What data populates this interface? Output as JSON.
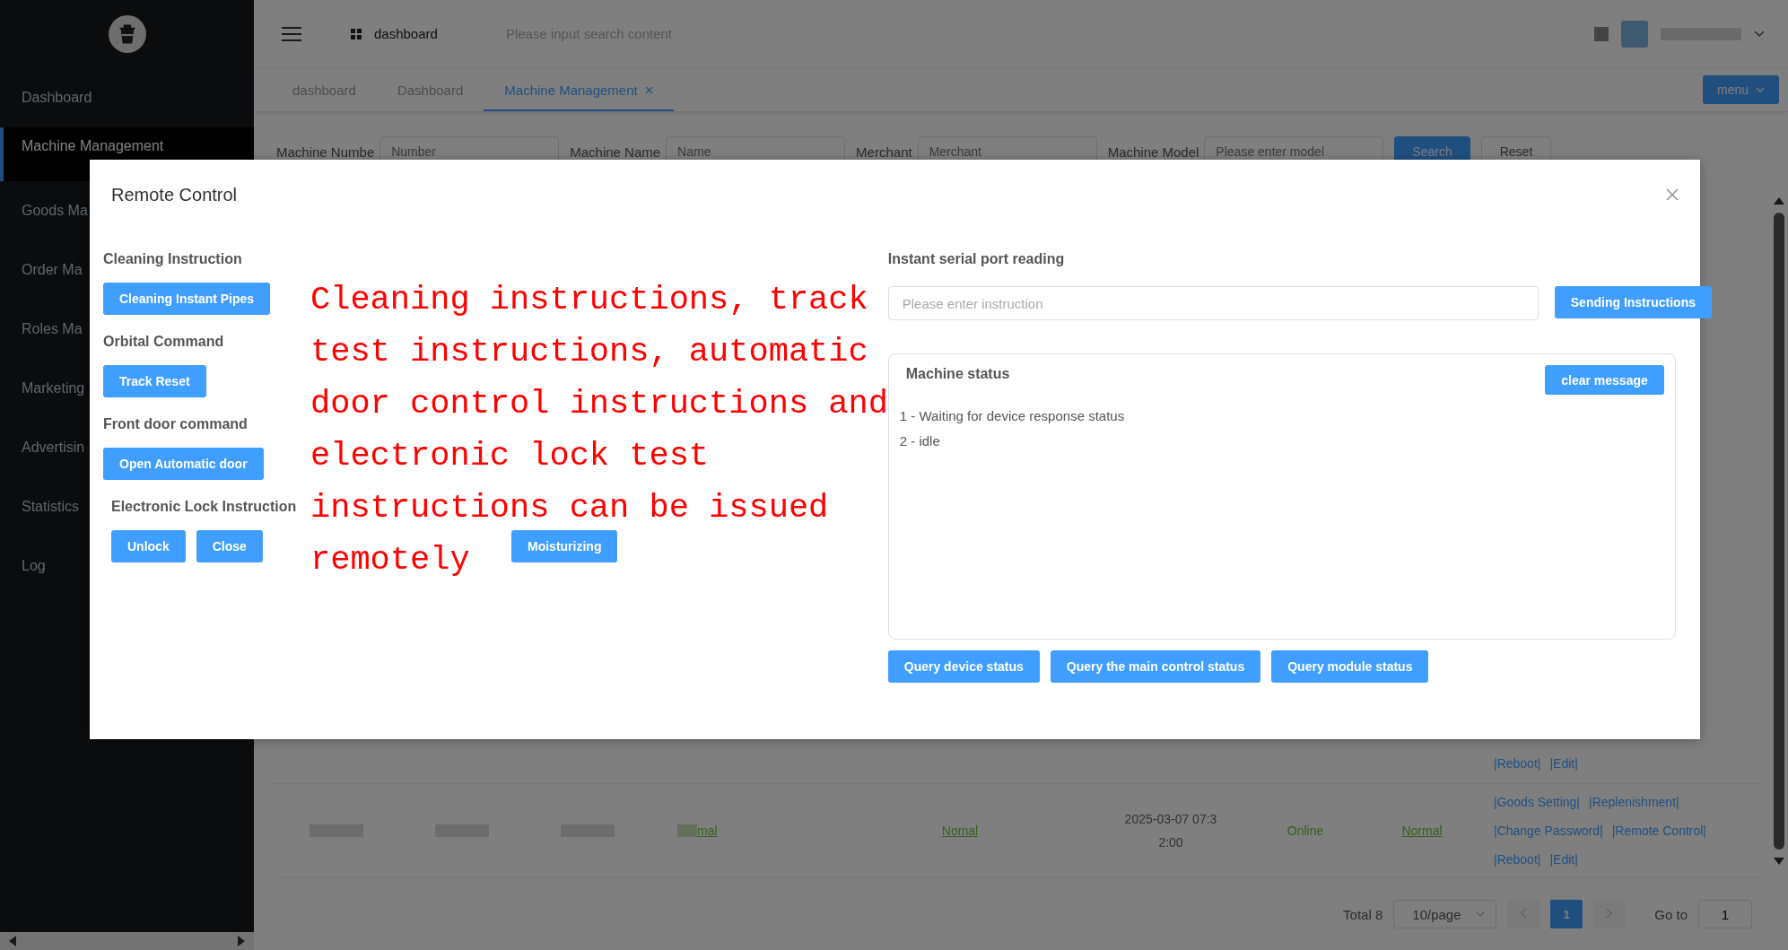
{
  "sidebar": {
    "items": [
      {
        "label": "Dashboard",
        "selected": false
      },
      {
        "label": "Machine Management",
        "selected": true
      },
      {
        "label": "Goods Ma",
        "selected": false
      },
      {
        "label": "Order Ma",
        "selected": false
      },
      {
        "label": "Roles Ma",
        "selected": false
      },
      {
        "label": "Marketing",
        "selected": false
      },
      {
        "label": "Advertisin",
        "selected": false
      },
      {
        "label": "Statistics",
        "selected": false
      },
      {
        "label": "Log",
        "selected": false
      }
    ]
  },
  "header": {
    "breadcrumb": "dashboard",
    "search": {
      "placeholder": "Please input search content"
    }
  },
  "tags": [
    {
      "label": "dashboard",
      "selected": false,
      "closable": false
    },
    {
      "label": "Dashboard",
      "selected": false,
      "closable": false
    },
    {
      "label": "Machine Management",
      "selected": true,
      "closable": true
    }
  ],
  "menu_button": "menu",
  "filters": [
    {
      "label": "Machine Numbe",
      "placeholder": "Number"
    },
    {
      "label": "Machine Name",
      "placeholder": "Name"
    },
    {
      "label": "Merchant",
      "placeholder": "Merchant"
    },
    {
      "label": "Machine Model",
      "placeholder": "Please enter model"
    }
  ],
  "filter_buttons": [
    {
      "label": "Search",
      "kind": "primary"
    },
    {
      "label": "Reset",
      "kind": "plain"
    }
  ],
  "table": {
    "rows": [
      {
        "cells": [],
        "actions": [
          [
            "|Reboot|",
            "|Edit|"
          ]
        ]
      },
      {
        "cells": [
          {
            "text": "mal",
            "kind": "link"
          },
          {
            "text": "Nomal",
            "kind": "link"
          },
          {
            "text": "2025-03-07 07:32:00",
            "kind": "time"
          },
          {
            "text": "Online",
            "kind": "status"
          },
          {
            "text": "Normal",
            "kind": "link"
          }
        ],
        "actions": [
          [
            "|Goods Setting|",
            "|Replenishment|"
          ],
          [
            "|Change Password|",
            "|Remote Control|"
          ],
          [
            "|Reboot|",
            "|Edit|"
          ]
        ]
      }
    ]
  },
  "pagination": {
    "total": "Total 8",
    "page_size": "10/page",
    "pages": [
      {
        "label": "1",
        "selected": true
      }
    ],
    "goto_label": "Go to",
    "goto_value": "1"
  },
  "modal": {
    "title": "Remote Control",
    "rows": [
      [
        {
          "heading": "Cleaning Instruction",
          "buttons": [
            "Cleaning Instant Pipes"
          ]
        }
      ],
      [
        {
          "heading": "Orbital Command",
          "buttons": [
            "Track Reset"
          ]
        }
      ],
      [
        {
          "heading": "Front door command",
          "buttons": [
            "Open Automatic door"
          ]
        }
      ],
      [
        {
          "heading": "Electronic Lock Instruction",
          "buttons": [
            "Unlock",
            "Close"
          ]
        },
        {
          "buttons": [
            "Moisturizing"
          ]
        }
      ]
    ],
    "serial": {
      "heading": "Instant serial port reading",
      "input": {
        "placeholder": "Please enter instruction"
      },
      "button": "Sending Instructions"
    },
    "status_panel": {
      "heading": "Machine status",
      "button": "clear message",
      "lines": [
        "1 - Waiting for device response status",
        "2 - idle"
      ]
    },
    "query_buttons": [
      "Query device status",
      "Query the main control status",
      "Query module status"
    ]
  },
  "annotation": {
    "lines": [
      "Cleaning instructions, track",
      "test instructions, automatic",
      "door control instructions and",
      "electronic lock test",
      "instructions can be issued",
      "remotely"
    ]
  }
}
